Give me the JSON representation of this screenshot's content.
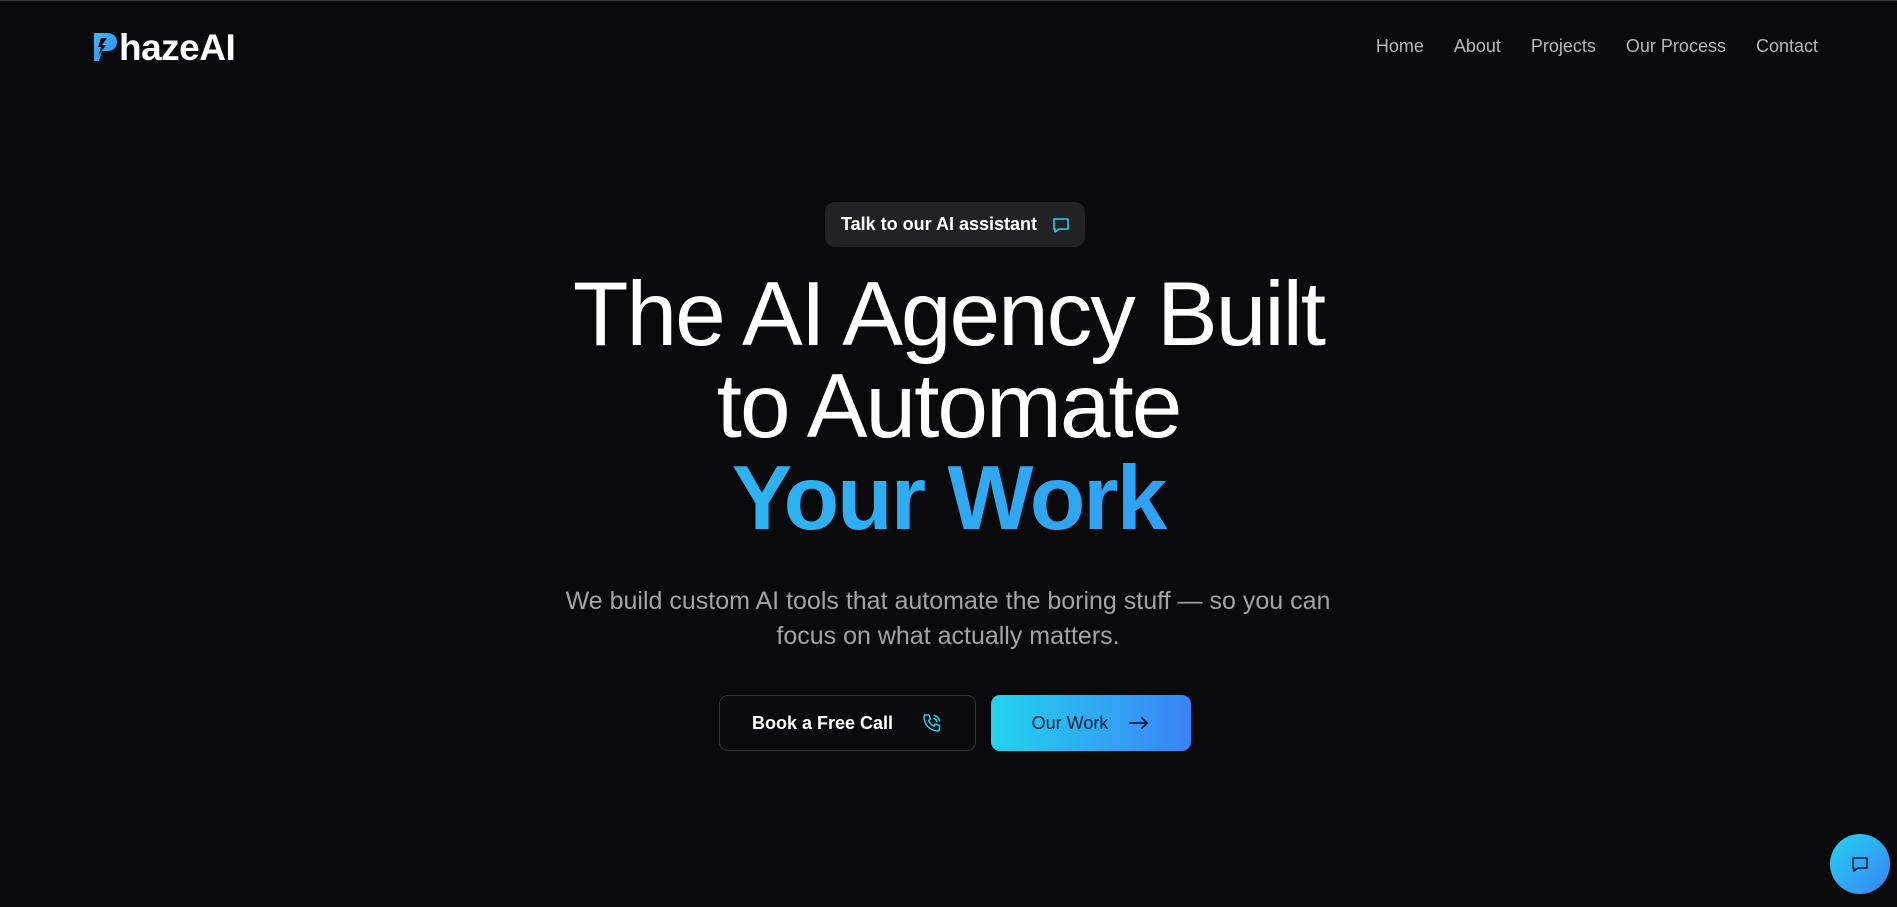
{
  "brand": {
    "logo_text": "hazeAI",
    "logo_icon": "p-bolt-icon",
    "accent_from": "#22d3ee",
    "accent_to": "#3b82f6"
  },
  "nav": {
    "items": [
      {
        "label": "Home"
      },
      {
        "label": "About"
      },
      {
        "label": "Projects"
      },
      {
        "label": "Our Process"
      },
      {
        "label": "Contact"
      }
    ]
  },
  "hero": {
    "pill": {
      "label": "Talk to our AI assistant",
      "icon": "chat-icon"
    },
    "headline_line1": "The AI Agency Built",
    "headline_line2": "to Automate",
    "headline_accent": "Your Work",
    "subtitle": "We build custom AI tools that automate the boring stuff — so you can focus on what actually matters.",
    "primary_button": {
      "label": "Book a Free Call",
      "icon": "phone-icon"
    },
    "secondary_button": {
      "label": "Our Work",
      "icon": "arrow-right-icon"
    }
  },
  "chat_widget": {
    "icon": "chat-icon"
  }
}
